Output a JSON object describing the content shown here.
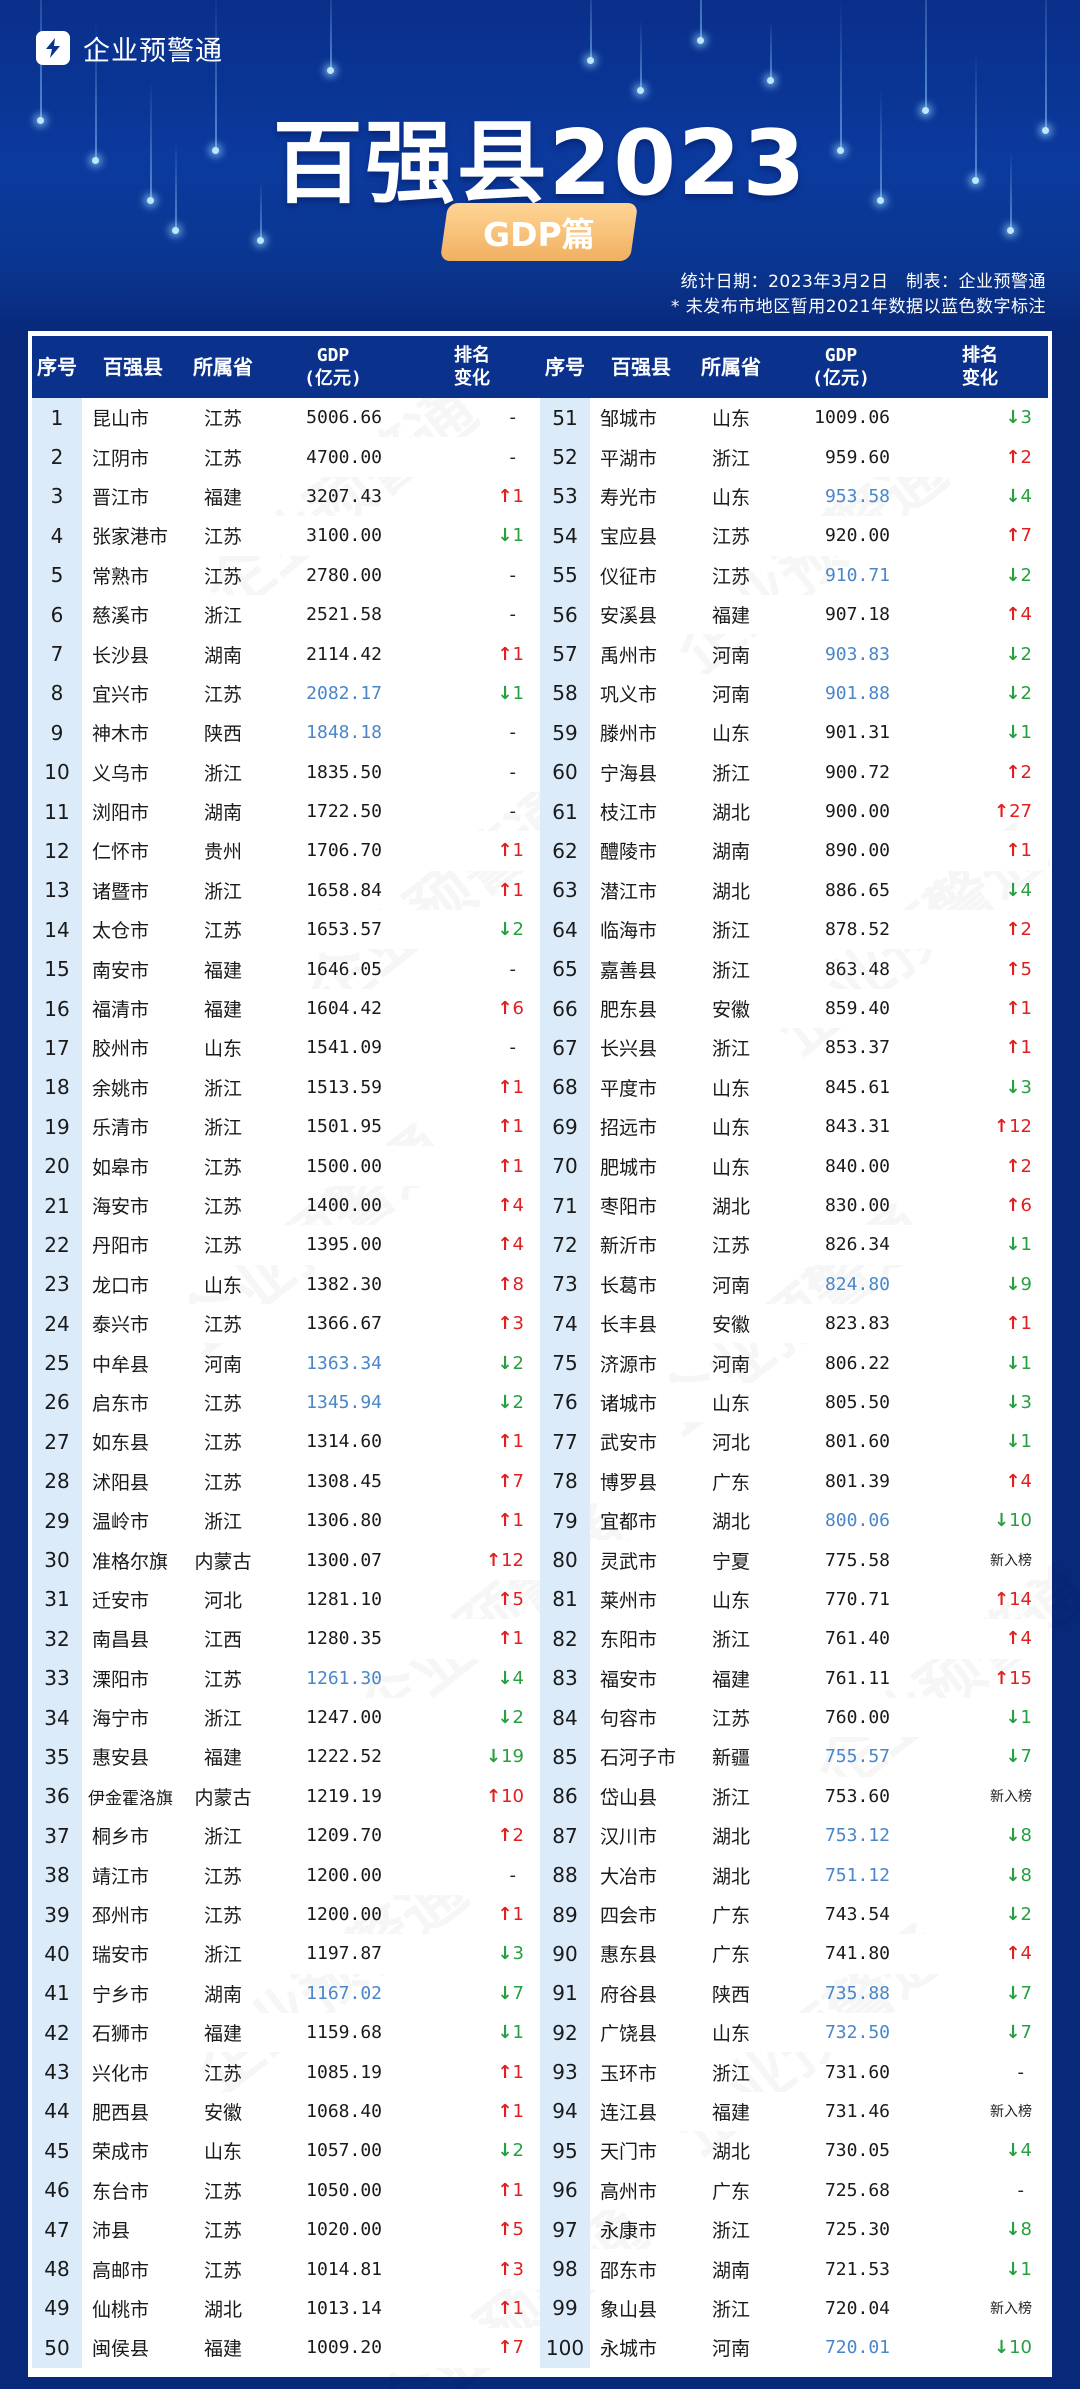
{
  "brand": {
    "icon": "lightning-icon",
    "name": "企业预警通"
  },
  "title": "百强县2023",
  "subtitle": "GDP篇",
  "meta": {
    "line1": "统计日期：2023年3月2日　制表：企业预警通",
    "line2": "* 未发布市地区暂用2021年数据以蓝色数字标注"
  },
  "columns": {
    "no": "序号",
    "county": "百强县",
    "province": "所属省",
    "gdp_line1": "GDP",
    "gdp_line2": "(亿元)",
    "change_line1": "排名",
    "change_line2": "变化"
  },
  "colors": {
    "estimated_gdp": "#4a86c8",
    "rank_up": "#e02020",
    "rank_down": "#27a040",
    "header_bg": "#0a318c"
  },
  "watermark": "企业预警通",
  "rows": [
    {
      "no": "1",
      "name": "昆山市",
      "prov": "江苏",
      "gdp": "5006.66",
      "chg": "-",
      "dir": "none",
      "est": false
    },
    {
      "no": "2",
      "name": "江阴市",
      "prov": "江苏",
      "gdp": "4700.00",
      "chg": "-",
      "dir": "none",
      "est": false
    },
    {
      "no": "3",
      "name": "晋江市",
      "prov": "福建",
      "gdp": "3207.43",
      "chg": "1",
      "dir": "up",
      "est": false
    },
    {
      "no": "4",
      "name": "张家港市",
      "prov": "江苏",
      "gdp": "3100.00",
      "chg": "1",
      "dir": "down",
      "est": false
    },
    {
      "no": "5",
      "name": "常熟市",
      "prov": "江苏",
      "gdp": "2780.00",
      "chg": "-",
      "dir": "none",
      "est": false
    },
    {
      "no": "6",
      "name": "慈溪市",
      "prov": "浙江",
      "gdp": "2521.58",
      "chg": "-",
      "dir": "none",
      "est": false
    },
    {
      "no": "7",
      "name": "长沙县",
      "prov": "湖南",
      "gdp": "2114.42",
      "chg": "1",
      "dir": "up",
      "est": false
    },
    {
      "no": "8",
      "name": "宜兴市",
      "prov": "江苏",
      "gdp": "2082.17",
      "chg": "1",
      "dir": "down",
      "est": true
    },
    {
      "no": "9",
      "name": "神木市",
      "prov": "陕西",
      "gdp": "1848.18",
      "chg": "-",
      "dir": "none",
      "est": true
    },
    {
      "no": "10",
      "name": "义乌市",
      "prov": "浙江",
      "gdp": "1835.50",
      "chg": "-",
      "dir": "none",
      "est": false
    },
    {
      "no": "11",
      "name": "浏阳市",
      "prov": "湖南",
      "gdp": "1722.50",
      "chg": "-",
      "dir": "none",
      "est": false
    },
    {
      "no": "12",
      "name": "仁怀市",
      "prov": "贵州",
      "gdp": "1706.70",
      "chg": "1",
      "dir": "up",
      "est": false
    },
    {
      "no": "13",
      "name": "诸暨市",
      "prov": "浙江",
      "gdp": "1658.84",
      "chg": "1",
      "dir": "up",
      "est": false
    },
    {
      "no": "14",
      "name": "太仓市",
      "prov": "江苏",
      "gdp": "1653.57",
      "chg": "2",
      "dir": "down",
      "est": false
    },
    {
      "no": "15",
      "name": "南安市",
      "prov": "福建",
      "gdp": "1646.05",
      "chg": "-",
      "dir": "none",
      "est": false
    },
    {
      "no": "16",
      "name": "福清市",
      "prov": "福建",
      "gdp": "1604.42",
      "chg": "6",
      "dir": "up",
      "est": false
    },
    {
      "no": "17",
      "name": "胶州市",
      "prov": "山东",
      "gdp": "1541.09",
      "chg": "-",
      "dir": "none",
      "est": false
    },
    {
      "no": "18",
      "name": "余姚市",
      "prov": "浙江",
      "gdp": "1513.59",
      "chg": "1",
      "dir": "up",
      "est": false
    },
    {
      "no": "19",
      "name": "乐清市",
      "prov": "浙江",
      "gdp": "1501.95",
      "chg": "1",
      "dir": "up",
      "est": false
    },
    {
      "no": "20",
      "name": "如皋市",
      "prov": "江苏",
      "gdp": "1500.00",
      "chg": "1",
      "dir": "up",
      "est": false
    },
    {
      "no": "21",
      "name": "海安市",
      "prov": "江苏",
      "gdp": "1400.00",
      "chg": "4",
      "dir": "up",
      "est": false
    },
    {
      "no": "22",
      "name": "丹阳市",
      "prov": "江苏",
      "gdp": "1395.00",
      "chg": "4",
      "dir": "up",
      "est": false
    },
    {
      "no": "23",
      "name": "龙口市",
      "prov": "山东",
      "gdp": "1382.30",
      "chg": "8",
      "dir": "up",
      "est": false
    },
    {
      "no": "24",
      "name": "泰兴市",
      "prov": "江苏",
      "gdp": "1366.67",
      "chg": "3",
      "dir": "up",
      "est": false
    },
    {
      "no": "25",
      "name": "中牟县",
      "prov": "河南",
      "gdp": "1363.34",
      "chg": "2",
      "dir": "down",
      "est": true
    },
    {
      "no": "26",
      "name": "启东市",
      "prov": "江苏",
      "gdp": "1345.94",
      "chg": "2",
      "dir": "down",
      "est": true
    },
    {
      "no": "27",
      "name": "如东县",
      "prov": "江苏",
      "gdp": "1314.60",
      "chg": "1",
      "dir": "up",
      "est": false
    },
    {
      "no": "28",
      "name": "沭阳县",
      "prov": "江苏",
      "gdp": "1308.45",
      "chg": "7",
      "dir": "up",
      "est": false
    },
    {
      "no": "29",
      "name": "温岭市",
      "prov": "浙江",
      "gdp": "1306.80",
      "chg": "1",
      "dir": "up",
      "est": false
    },
    {
      "no": "30",
      "name": "准格尔旗",
      "prov": "内蒙古",
      "gdp": "1300.07",
      "chg": "12",
      "dir": "up",
      "est": false
    },
    {
      "no": "31",
      "name": "迁安市",
      "prov": "河北",
      "gdp": "1281.10",
      "chg": "5",
      "dir": "up",
      "est": false
    },
    {
      "no": "32",
      "name": "南昌县",
      "prov": "江西",
      "gdp": "1280.35",
      "chg": "1",
      "dir": "up",
      "est": false
    },
    {
      "no": "33",
      "name": "溧阳市",
      "prov": "江苏",
      "gdp": "1261.30",
      "chg": "4",
      "dir": "down",
      "est": true
    },
    {
      "no": "34",
      "name": "海宁市",
      "prov": "浙江",
      "gdp": "1247.00",
      "chg": "2",
      "dir": "down",
      "est": false
    },
    {
      "no": "35",
      "name": "惠安县",
      "prov": "福建",
      "gdp": "1222.52",
      "chg": "19",
      "dir": "down",
      "est": false
    },
    {
      "no": "36",
      "name": "伊金霍洛旗",
      "prov": "内蒙古",
      "gdp": "1219.19",
      "chg": "10",
      "dir": "up",
      "est": false
    },
    {
      "no": "37",
      "name": "桐乡市",
      "prov": "浙江",
      "gdp": "1209.70",
      "chg": "2",
      "dir": "up",
      "est": false
    },
    {
      "no": "38",
      "name": "靖江市",
      "prov": "江苏",
      "gdp": "1200.00",
      "chg": "-",
      "dir": "none",
      "est": false
    },
    {
      "no": "39",
      "name": "邳州市",
      "prov": "江苏",
      "gdp": "1200.00",
      "chg": "1",
      "dir": "up",
      "est": false
    },
    {
      "no": "40",
      "name": "瑞安市",
      "prov": "浙江",
      "gdp": "1197.87",
      "chg": "3",
      "dir": "down",
      "est": false
    },
    {
      "no": "41",
      "name": "宁乡市",
      "prov": "湖南",
      "gdp": "1167.02",
      "chg": "7",
      "dir": "down",
      "est": true
    },
    {
      "no": "42",
      "name": "石狮市",
      "prov": "福建",
      "gdp": "1159.68",
      "chg": "1",
      "dir": "down",
      "est": false
    },
    {
      "no": "43",
      "name": "兴化市",
      "prov": "江苏",
      "gdp": "1085.19",
      "chg": "1",
      "dir": "up",
      "est": false
    },
    {
      "no": "44",
      "name": "肥西县",
      "prov": "安徽",
      "gdp": "1068.40",
      "chg": "1",
      "dir": "up",
      "est": false
    },
    {
      "no": "45",
      "name": "荣成市",
      "prov": "山东",
      "gdp": "1057.00",
      "chg": "2",
      "dir": "down",
      "est": false
    },
    {
      "no": "46",
      "name": "东台市",
      "prov": "江苏",
      "gdp": "1050.00",
      "chg": "1",
      "dir": "up",
      "est": false
    },
    {
      "no": "47",
      "name": "沛县",
      "prov": "江苏",
      "gdp": "1020.00",
      "chg": "5",
      "dir": "up",
      "est": false
    },
    {
      "no": "48",
      "name": "高邮市",
      "prov": "江苏",
      "gdp": "1014.81",
      "chg": "3",
      "dir": "up",
      "est": false
    },
    {
      "no": "49",
      "name": "仙桃市",
      "prov": "湖北",
      "gdp": "1013.14",
      "chg": "1",
      "dir": "up",
      "est": false
    },
    {
      "no": "50",
      "name": "闽侯县",
      "prov": "福建",
      "gdp": "1009.20",
      "chg": "7",
      "dir": "up",
      "est": false
    },
    {
      "no": "51",
      "name": "邹城市",
      "prov": "山东",
      "gdp": "1009.06",
      "chg": "3",
      "dir": "down",
      "est": false
    },
    {
      "no": "52",
      "name": "平湖市",
      "prov": "浙江",
      "gdp": "959.60",
      "chg": "2",
      "dir": "up",
      "est": false
    },
    {
      "no": "53",
      "name": "寿光市",
      "prov": "山东",
      "gdp": "953.58",
      "chg": "4",
      "dir": "down",
      "est": true
    },
    {
      "no": "54",
      "name": "宝应县",
      "prov": "江苏",
      "gdp": "920.00",
      "chg": "7",
      "dir": "up",
      "est": false
    },
    {
      "no": "55",
      "name": "仪征市",
      "prov": "江苏",
      "gdp": "910.71",
      "chg": "2",
      "dir": "down",
      "est": true
    },
    {
      "no": "56",
      "name": "安溪县",
      "prov": "福建",
      "gdp": "907.18",
      "chg": "4",
      "dir": "up",
      "est": false
    },
    {
      "no": "57",
      "name": "禹州市",
      "prov": "河南",
      "gdp": "903.83",
      "chg": "2",
      "dir": "down",
      "est": true
    },
    {
      "no": "58",
      "name": "巩义市",
      "prov": "河南",
      "gdp": "901.88",
      "chg": "2",
      "dir": "down",
      "est": true
    },
    {
      "no": "59",
      "name": "滕州市",
      "prov": "山东",
      "gdp": "901.31",
      "chg": "1",
      "dir": "down",
      "est": false
    },
    {
      "no": "60",
      "name": "宁海县",
      "prov": "浙江",
      "gdp": "900.72",
      "chg": "2",
      "dir": "up",
      "est": false
    },
    {
      "no": "61",
      "name": "枝江市",
      "prov": "湖北",
      "gdp": "900.00",
      "chg": "27",
      "dir": "up",
      "est": false
    },
    {
      "no": "62",
      "name": "醴陵市",
      "prov": "湖南",
      "gdp": "890.00",
      "chg": "1",
      "dir": "up",
      "est": false
    },
    {
      "no": "63",
      "name": "潜江市",
      "prov": "湖北",
      "gdp": "886.65",
      "chg": "4",
      "dir": "down",
      "est": false
    },
    {
      "no": "64",
      "name": "临海市",
      "prov": "浙江",
      "gdp": "878.52",
      "chg": "2",
      "dir": "up",
      "est": false
    },
    {
      "no": "65",
      "name": "嘉善县",
      "prov": "浙江",
      "gdp": "863.48",
      "chg": "5",
      "dir": "up",
      "est": false
    },
    {
      "no": "66",
      "name": "肥东县",
      "prov": "安徽",
      "gdp": "859.40",
      "chg": "1",
      "dir": "up",
      "est": false
    },
    {
      "no": "67",
      "name": "长兴县",
      "prov": "浙江",
      "gdp": "853.37",
      "chg": "1",
      "dir": "up",
      "est": false
    },
    {
      "no": "68",
      "name": "平度市",
      "prov": "山东",
      "gdp": "845.61",
      "chg": "3",
      "dir": "down",
      "est": false
    },
    {
      "no": "69",
      "name": "招远市",
      "prov": "山东",
      "gdp": "843.31",
      "chg": "12",
      "dir": "up",
      "est": false
    },
    {
      "no": "70",
      "name": "肥城市",
      "prov": "山东",
      "gdp": "840.00",
      "chg": "2",
      "dir": "up",
      "est": false
    },
    {
      "no": "71",
      "name": "枣阳市",
      "prov": "湖北",
      "gdp": "830.00",
      "chg": "6",
      "dir": "up",
      "est": false
    },
    {
      "no": "72",
      "name": "新沂市",
      "prov": "江苏",
      "gdp": "826.34",
      "chg": "1",
      "dir": "down",
      "est": false
    },
    {
      "no": "73",
      "name": "长葛市",
      "prov": "河南",
      "gdp": "824.80",
      "chg": "9",
      "dir": "down",
      "est": true
    },
    {
      "no": "74",
      "name": "长丰县",
      "prov": "安徽",
      "gdp": "823.83",
      "chg": "1",
      "dir": "up",
      "est": false
    },
    {
      "no": "75",
      "name": "济源市",
      "prov": "河南",
      "gdp": "806.22",
      "chg": "1",
      "dir": "down",
      "est": false
    },
    {
      "no": "76",
      "name": "诸城市",
      "prov": "山东",
      "gdp": "805.50",
      "chg": "3",
      "dir": "down",
      "est": false
    },
    {
      "no": "77",
      "name": "武安市",
      "prov": "河北",
      "gdp": "801.60",
      "chg": "1",
      "dir": "down",
      "est": false
    },
    {
      "no": "78",
      "name": "博罗县",
      "prov": "广东",
      "gdp": "801.39",
      "chg": "4",
      "dir": "up",
      "est": false
    },
    {
      "no": "79",
      "name": "宜都市",
      "prov": "湖北",
      "gdp": "800.06",
      "chg": "10",
      "dir": "down",
      "est": true
    },
    {
      "no": "80",
      "name": "灵武市",
      "prov": "宁夏",
      "gdp": "775.58",
      "chg": "新入榜",
      "dir": "new",
      "est": false
    },
    {
      "no": "81",
      "name": "莱州市",
      "prov": "山东",
      "gdp": "770.71",
      "chg": "14",
      "dir": "up",
      "est": false
    },
    {
      "no": "82",
      "name": "东阳市",
      "prov": "浙江",
      "gdp": "761.40",
      "chg": "4",
      "dir": "up",
      "est": false
    },
    {
      "no": "83",
      "name": "福安市",
      "prov": "福建",
      "gdp": "761.11",
      "chg": "15",
      "dir": "up",
      "est": false
    },
    {
      "no": "84",
      "name": "句容市",
      "prov": "江苏",
      "gdp": "760.00",
      "chg": "1",
      "dir": "down",
      "est": false
    },
    {
      "no": "85",
      "name": "石河子市",
      "prov": "新疆",
      "gdp": "755.57",
      "chg": "7",
      "dir": "down",
      "est": true
    },
    {
      "no": "86",
      "name": "岱山县",
      "prov": "浙江",
      "gdp": "753.60",
      "chg": "新入榜",
      "dir": "new",
      "est": false
    },
    {
      "no": "87",
      "name": "汉川市",
      "prov": "湖北",
      "gdp": "753.12",
      "chg": "8",
      "dir": "down",
      "est": true
    },
    {
      "no": "88",
      "name": "大冶市",
      "prov": "湖北",
      "gdp": "751.12",
      "chg": "8",
      "dir": "down",
      "est": true
    },
    {
      "no": "89",
      "name": "四会市",
      "prov": "广东",
      "gdp": "743.54",
      "chg": "2",
      "dir": "down",
      "est": false
    },
    {
      "no": "90",
      "name": "惠东县",
      "prov": "广东",
      "gdp": "741.80",
      "chg": "4",
      "dir": "up",
      "est": false
    },
    {
      "no": "91",
      "name": "府谷县",
      "prov": "陕西",
      "gdp": "735.88",
      "chg": "7",
      "dir": "down",
      "est": true
    },
    {
      "no": "92",
      "name": "广饶县",
      "prov": "山东",
      "gdp": "732.50",
      "chg": "7",
      "dir": "down",
      "est": true
    },
    {
      "no": "93",
      "name": "玉环市",
      "prov": "浙江",
      "gdp": "731.60",
      "chg": "-",
      "dir": "none",
      "est": false
    },
    {
      "no": "94",
      "name": "连江县",
      "prov": "福建",
      "gdp": "731.46",
      "chg": "新入榜",
      "dir": "new",
      "est": false
    },
    {
      "no": "95",
      "name": "天门市",
      "prov": "湖北",
      "gdp": "730.05",
      "chg": "4",
      "dir": "down",
      "est": false
    },
    {
      "no": "96",
      "name": "高州市",
      "prov": "广东",
      "gdp": "725.68",
      "chg": "-",
      "dir": "none",
      "est": false
    },
    {
      "no": "97",
      "name": "永康市",
      "prov": "浙江",
      "gdp": "725.30",
      "chg": "8",
      "dir": "down",
      "est": false
    },
    {
      "no": "98",
      "name": "邵东市",
      "prov": "湖南",
      "gdp": "721.53",
      "chg": "1",
      "dir": "down",
      "est": false
    },
    {
      "no": "99",
      "name": "象山县",
      "prov": "浙江",
      "gdp": "720.04",
      "chg": "新入榜",
      "dir": "new",
      "est": false
    },
    {
      "no": "100",
      "name": "永城市",
      "prov": "河南",
      "gdp": "720.01",
      "chg": "10",
      "dir": "down",
      "est": true
    }
  ]
}
